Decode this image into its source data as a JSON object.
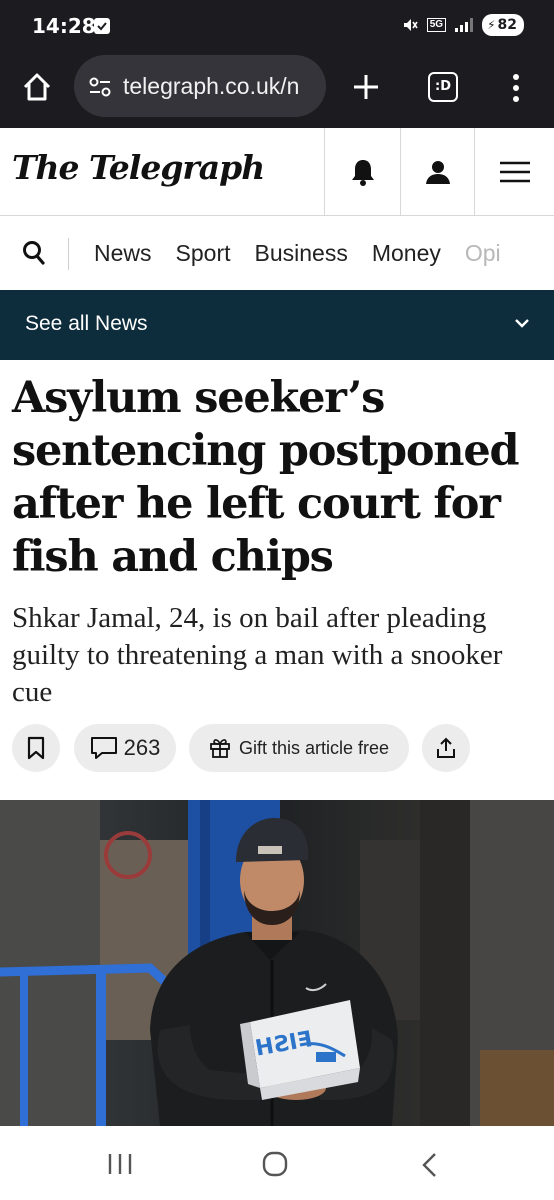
{
  "status_bar": {
    "time": "14:28",
    "network": "5G",
    "battery": "82",
    "icons": [
      "notification-icon",
      "mute-icon",
      "5g-icon",
      "signal-icon",
      "battery-icon"
    ]
  },
  "browser": {
    "url": "telegraph.co.uk/n",
    "tab_count_label": ":D",
    "icons": [
      "home-icon",
      "site-settings-icon",
      "plus-icon",
      "tabs-icon",
      "more-vert-icon"
    ]
  },
  "site_header": {
    "logo": "The Telegraph",
    "icons": [
      "bell-icon",
      "user-icon",
      "hamburger-icon"
    ]
  },
  "nav": {
    "items": [
      "News",
      "Sport",
      "Business",
      "Money",
      "Opi"
    ]
  },
  "section_bar": {
    "label": "See all News"
  },
  "article": {
    "headline": "Asylum seeker’s sentencing postponed after he left court for fish and chips",
    "standfirst": "Shkar Jamal, 24, is on bail after pleading guilty to threatening a man with a snooker cue",
    "comment_count": "263",
    "gift_label": "Gift this article free"
  },
  "photo": {
    "box_text": "FISH"
  },
  "colors": {
    "browser_chrome": "#1c1b1f",
    "section_bar": "#0d2c3c",
    "button_bg": "#ececec"
  }
}
